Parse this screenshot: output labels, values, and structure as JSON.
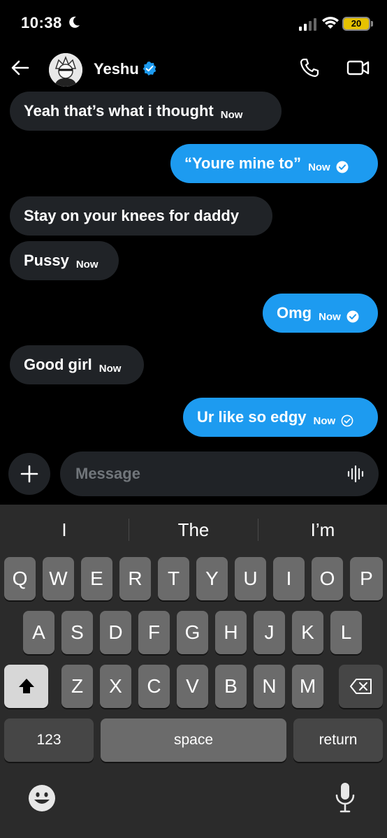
{
  "status_bar": {
    "time": "10:38",
    "battery": "20"
  },
  "header": {
    "name": "Yeshu"
  },
  "messages": [
    {
      "text": "Yeah that’s what i thought",
      "time": "Now"
    },
    {
      "text": "“Youre mine to”",
      "time": "Now"
    },
    {
      "text": "Stay on your knees for daddy"
    },
    {
      "text": "Pussy",
      "time": "Now"
    },
    {
      "text": "Omg",
      "time": "Now"
    },
    {
      "text": "Good girl",
      "time": "Now"
    },
    {
      "text": "Ur like so edgy",
      "time": "Now"
    }
  ],
  "composer": {
    "placeholder": "Message"
  },
  "keyboard": {
    "suggestions": [
      "I",
      "The",
      "I’m"
    ],
    "row1": [
      "Q",
      "W",
      "E",
      "R",
      "T",
      "Y",
      "U",
      "I",
      "O",
      "P"
    ],
    "row2": [
      "A",
      "S",
      "D",
      "F",
      "G",
      "H",
      "J",
      "K",
      "L"
    ],
    "row3": [
      "Z",
      "X",
      "C",
      "V",
      "B",
      "N",
      "M"
    ],
    "numbers": "123",
    "space": "space",
    "return": "return"
  },
  "colors": {
    "sent_bubble": "#1d9bf0",
    "received_bubble": "#202327",
    "verified": "#1d9bf0"
  }
}
